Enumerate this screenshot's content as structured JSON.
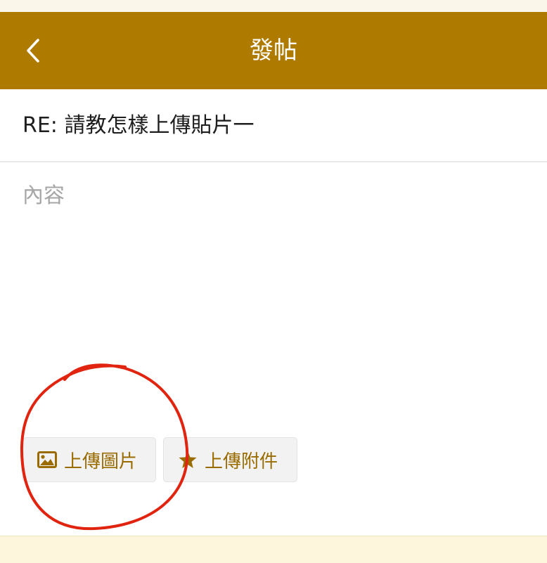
{
  "header": {
    "title": "發帖",
    "back_icon": "chevron-left-icon",
    "background_color": "#ae7b00"
  },
  "form": {
    "subject_value": "RE: 請教怎樣上傳貼片一",
    "content_placeholder": "內容"
  },
  "toolbar": {
    "upload_image_label": "上傳圖片",
    "upload_image_icon": "image-icon",
    "upload_attachment_label": "上傳附件",
    "upload_attachment_icon": "star-icon",
    "accent_color": "#9a6c00"
  },
  "annotation": {
    "type": "hand-drawn red circle around upload image button",
    "color": "#e0240f"
  }
}
